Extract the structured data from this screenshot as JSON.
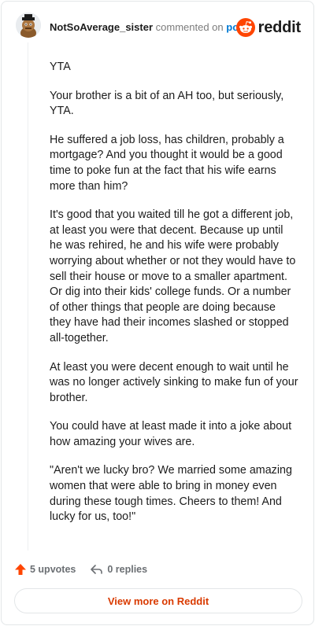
{
  "header": {
    "username": "NotSoAverage_sister",
    "commented_on_text": "commented on",
    "post_link": "post",
    "brand_name": "reddit"
  },
  "comment": {
    "paragraphs": [
      "YTA",
      "Your brother is a bit of an AH too, but seriously, YTA.",
      "He suffered a job loss, has children, probably a mortgage? And you thought it would be a good time to poke fun at the fact that his wife earns more than him?",
      "It's good that you waited till he got a different job, at least you were that decent. Because up until he was rehired, he and his wife were probably worrying about whether or not they would have to sell their house or move to a smaller apartment. Or dig into their kids' college funds. Or a number of other things that people are doing because they have had their incomes slashed or stopped all-together.",
      "At least you were decent enough to wait until he was no longer actively sinking to make fun of your brother.",
      "You could have at least made it into a joke about how amazing your wives are.",
      "\"Aren't we lucky bro? We married some amazing women that were able to bring in money even during these tough times. Cheers to them! And lucky for us, too!\""
    ]
  },
  "actions": {
    "upvotes": "5 upvotes",
    "replies": "0 replies"
  },
  "footer": {
    "view_more": "View more on Reddit"
  },
  "colors": {
    "upvote": "#ff4500",
    "link": "#0079d3",
    "cta": "#d93a00",
    "brand": "#ff4500"
  },
  "icons": {
    "upvote": "upvote-arrow-icon",
    "reply": "reply-arrow-icon",
    "brand": "reddit-snoo-icon",
    "avatar": "user-avatar-icon"
  }
}
